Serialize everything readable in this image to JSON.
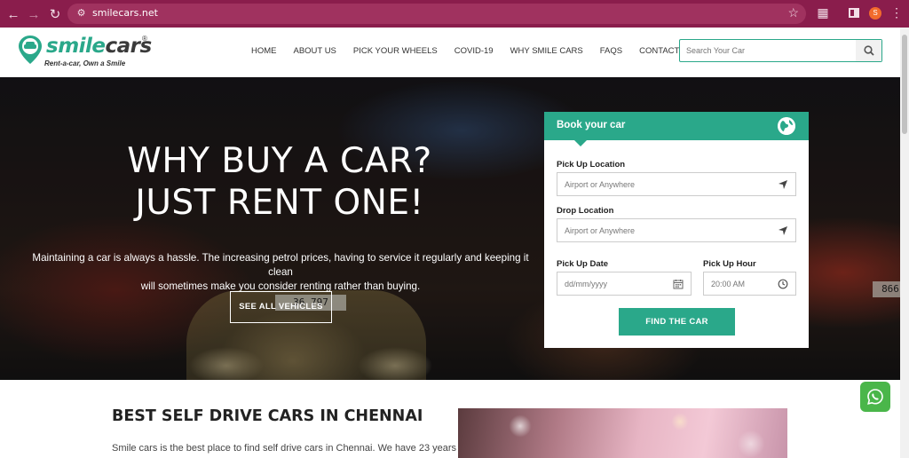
{
  "browser": {
    "url": "smilecars.net",
    "profile_initial": "S"
  },
  "brand": {
    "name_part1": "smile",
    "name_part2": "cars",
    "registered_mark": "®",
    "tagline": "Rent-a-car, Own a Smile",
    "color": "#2aa88a"
  },
  "nav": {
    "items": [
      {
        "label": "HOME"
      },
      {
        "label": "ABOUT US"
      },
      {
        "label": "PICK YOUR WHEELS"
      },
      {
        "label": "COVID-19"
      },
      {
        "label": "WHY SMILE CARS"
      },
      {
        "label": "FAQS"
      },
      {
        "label": "CONTACT US"
      }
    ],
    "search_placeholder": "Search Your Car"
  },
  "hero": {
    "title_line1": "WHY BUY A CAR?",
    "title_line2": "JUST RENT ONE!",
    "description_line1": "Maintaining a car is always a hassle. The increasing petrol prices, having to service it regularly and keeping it clean",
    "description_line2": "will sometimes make you consider renting rather than buying.",
    "cta_label": "SEE ALL VEHICLES",
    "plate_text": "36 797",
    "plate2_text": "866"
  },
  "booking": {
    "title": "Book your car",
    "pickup_label": "Pick Up Location",
    "pickup_placeholder": "Airport or Anywhere",
    "drop_label": "Drop Location",
    "drop_placeholder": "Airport or Anywhere",
    "date_label": "Pick Up Date",
    "date_placeholder": "dd/mm/yyyy",
    "hour_label": "Pick Up Hour",
    "hour_value": "20:00 AM",
    "submit_label": "FIND THE CAR"
  },
  "section": {
    "title": "BEST SELF DRIVE CARS IN CHENNAI",
    "text": "Smile cars is the best place to find self drive cars in Chennai. We have 23 years"
  }
}
